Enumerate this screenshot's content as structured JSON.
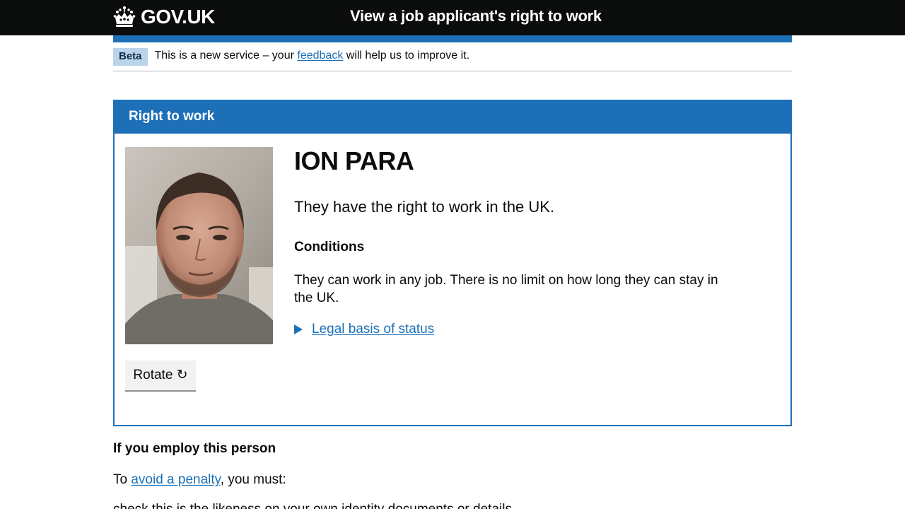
{
  "header": {
    "logo_text": "GOV.UK",
    "service_name": "View a job applicant's right to work"
  },
  "phase_banner": {
    "tag": "Beta",
    "text_before": "This is a new service – your",
    "link_text": "feedback",
    "text_after": "will help us to improve it."
  },
  "panel": {
    "title": "Right to work",
    "person_name": "ION PARA",
    "status": "They have the right to work in the UK.",
    "conditions_heading": "Conditions",
    "conditions_text": "They can work in any job. There is no limit on how long they can stay in the UK.",
    "details_link": "Legal basis of status",
    "rotate_label": "Rotate ↻",
    "photo_icon": "applicant-photo"
  },
  "employ": {
    "heading": "If you employ this person",
    "text_before": "To",
    "link_text": "avoid a penalty",
    "text_after": ", you must:",
    "next_line": "check this is the likeness on your own identity documents or details"
  },
  "colors": {
    "header_bg": "#0b0c0c",
    "brand_blue": "#1d70b8",
    "beta_tag_bg": "#bbd4ea",
    "button_bg": "#f3f2f1"
  }
}
